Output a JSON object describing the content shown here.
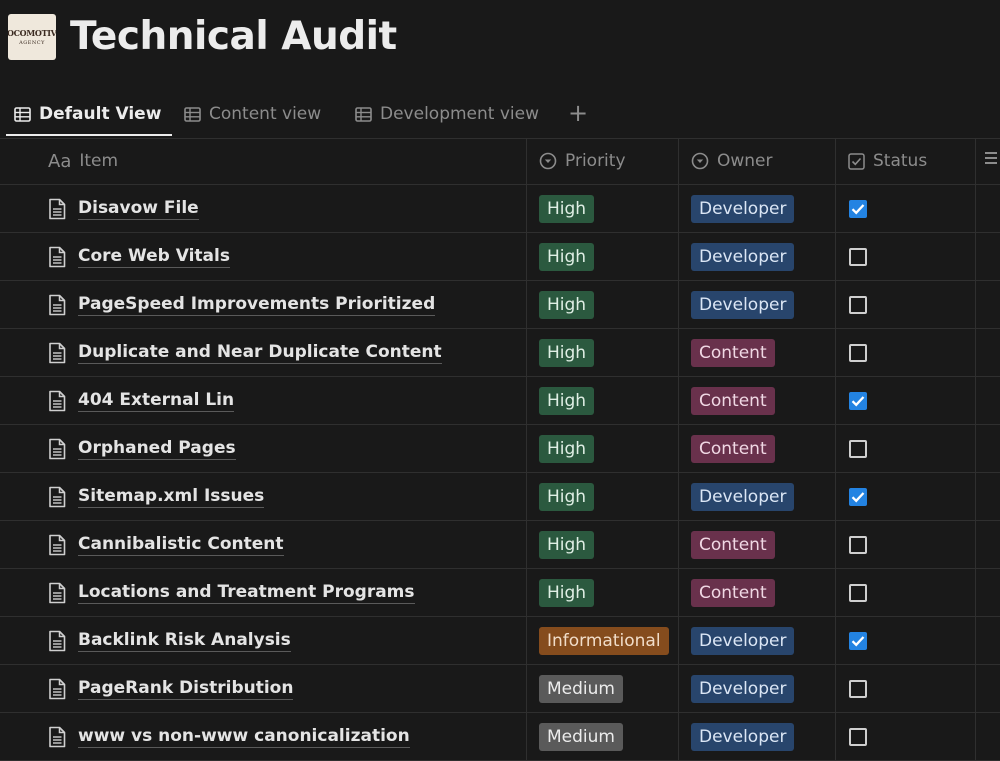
{
  "page": {
    "title": "Technical Audit",
    "logo_line1": "LOCOMOTIVE",
    "logo_line2": "AGENCY"
  },
  "tabs": [
    {
      "label": "Default View",
      "active": true
    },
    {
      "label": "Content view",
      "active": false
    },
    {
      "label": "Development view",
      "active": false
    }
  ],
  "add_tab_label": "+",
  "columns": {
    "item": {
      "icon": "Aa",
      "label": "Item"
    },
    "priority": {
      "label": "Priority"
    },
    "owner": {
      "label": "Owner"
    },
    "status": {
      "label": "Status"
    }
  },
  "rows": [
    {
      "item": "Disavow File",
      "priority": "High",
      "owner": "Developer",
      "done": true
    },
    {
      "item": "Core Web Vitals",
      "priority": "High",
      "owner": "Developer",
      "done": false
    },
    {
      "item": "PageSpeed Improvements Prioritized",
      "priority": "High",
      "owner": "Developer",
      "done": false
    },
    {
      "item": "Duplicate and Near Duplicate Content",
      "priority": "High",
      "owner": "Content",
      "done": false
    },
    {
      "item": "404 External Lin",
      "priority": "High",
      "owner": "Content",
      "done": true
    },
    {
      "item": "Orphaned Pages",
      "priority": "High",
      "owner": "Content",
      "done": false
    },
    {
      "item": "Sitemap.xml Issues",
      "priority": "High",
      "owner": "Developer",
      "done": true
    },
    {
      "item": "Cannibalistic Content",
      "priority": "High",
      "owner": "Content",
      "done": false
    },
    {
      "item": "Locations and Treatment Programs",
      "priority": "High",
      "owner": "Content",
      "done": false
    },
    {
      "item": "Backlink Risk Analysis",
      "priority": "Informational",
      "owner": "Developer",
      "done": true
    },
    {
      "item": "PageRank Distribution",
      "priority": "Medium",
      "owner": "Developer",
      "done": false
    },
    {
      "item": "www vs non-www canonicalization",
      "priority": "Medium",
      "owner": "Developer",
      "done": false
    }
  ],
  "colors": {
    "background": "#191919",
    "high": "#2b593f",
    "informational": "#854c1d",
    "medium": "#5a5a5a",
    "developer": "#28456c",
    "content": "#69314c",
    "checkbox_checked": "#2383e2"
  }
}
